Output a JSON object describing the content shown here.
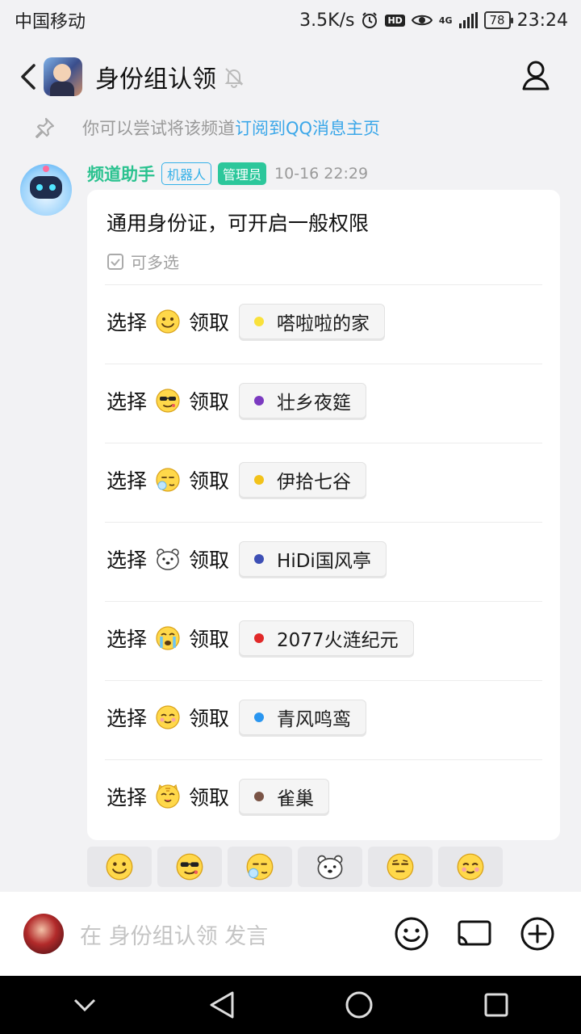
{
  "status_bar": {
    "carrier": "中国移动",
    "speed": "3.5K/s",
    "hd": "HD",
    "network": "4G",
    "battery": "78",
    "time": "23:24"
  },
  "header": {
    "title": "身份组认领"
  },
  "notice": {
    "text": "你可以尝试将该频道",
    "link": "订阅到QQ消息主页"
  },
  "message": {
    "sender": "频道助手",
    "tag_bot": "机器人",
    "tag_admin": "管理员",
    "time": "10-16 22:29",
    "card": {
      "title": "通用身份证，可开启一般权限",
      "multi_select": "可多选",
      "select_label": "选择",
      "claim_label": "领取",
      "options": [
        {
          "emoji": "smile-emoji",
          "role": "嗒啦啦的家",
          "color": "#f9e13b"
        },
        {
          "emoji": "cool-sunglasses-emoji",
          "role": "壮乡夜筵",
          "color": "#7b3ac0"
        },
        {
          "emoji": "sleepy-emoji",
          "role": "伊拾七谷",
          "color": "#f2c21a"
        },
        {
          "emoji": "polar-bear-emoji",
          "role": "HiDi国风亭",
          "color": "#3d4fb5"
        },
        {
          "emoji": "crying-emoji",
          "role": "2077火涟纪元",
          "color": "#e12929"
        },
        {
          "emoji": "blush-emoji",
          "role": "青风鸣鸾",
          "color": "#2a96f0"
        },
        {
          "emoji": "cat-emoji",
          "role": "雀巢",
          "color": "#7a5446"
        }
      ]
    }
  },
  "reactions": [
    "smile-emoji",
    "cool-sunglasses-emoji",
    "sleepy-emoji",
    "polar-bear-emoji",
    "unamused-emoji",
    "blush-emoji"
  ],
  "input_bar": {
    "placeholder": "在 身份组认领 发言"
  }
}
